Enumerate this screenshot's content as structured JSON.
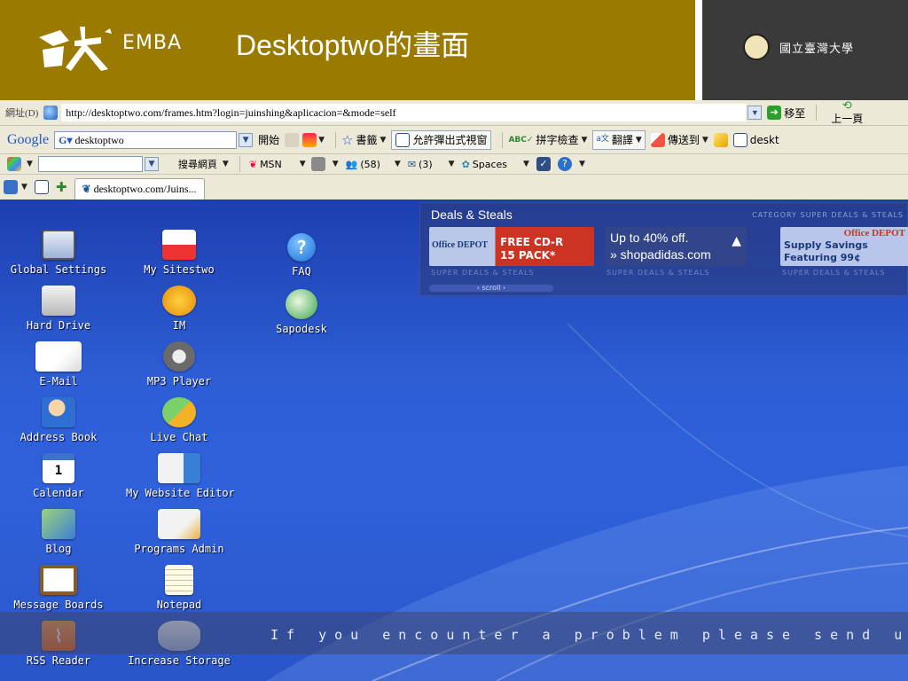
{
  "header": {
    "emba_label": "EMBA",
    "title": "Desktoptwo的畫面",
    "university": "國立臺灣大學"
  },
  "address_bar": {
    "label": "網址(D)",
    "url": "http://desktoptwo.com/frames.htm?login=juinshing&aplicacion=&mode=self",
    "go_label": "移至",
    "back_label": "上一頁"
  },
  "google_bar": {
    "logo": "Google",
    "search_value": "desktoptwo",
    "start_label": "開始",
    "bookmarks_label": "書籤",
    "popups_label": "允許彈出式視窗",
    "spellcheck_label": "拼字檢查",
    "translate_label": "翻譯",
    "sendto_label": "傳送到",
    "extra_label": "deskt"
  },
  "links_bar": {
    "search_web_label": "搜尋網頁",
    "msn_label": "MSN",
    "buddies_count": "(58)",
    "mail_count": "(3)",
    "spaces_label": "Spaces"
  },
  "tab": {
    "label": "desktoptwo.com/Juins..."
  },
  "deals": {
    "title": "Deals & Steals",
    "category": "CATEGORY SUPER DEALS & STEALS",
    "ad1_text1": "Office DEPOT",
    "ad1_text2": "FREE CD-R",
    "ad1_text3": "15 PACK*",
    "ad2_text1": "Up to 40% off.",
    "ad2_text2": "» shopadidas.com",
    "ad3_text1": "Office DEPOT",
    "ad3_text2": "Supply Savings",
    "ad3_text3": "Featuring 99¢",
    "caption": "SUPER DEALS & STEALS",
    "scroll_label": "‹ scroll ›"
  },
  "desktop_icons": {
    "global_settings": "Global Settings",
    "my_sitestwo": "My Sitestwo",
    "faq": "FAQ",
    "hard_drive": "Hard Drive",
    "im": "IM",
    "sapodesk": "Sapodesk",
    "email": "E-Mail",
    "mp3_player": "MP3 Player",
    "address_book": "Address Book",
    "live_chat": "Live Chat",
    "calendar": "Calendar",
    "calendar_day": "1",
    "website_editor": "My Website Editor",
    "blog": "Blog",
    "programs_admin": "Programs Admin",
    "message_boards": "Message Boards",
    "notepad": "Notepad",
    "rss_reader": "RSS Reader",
    "increase_storage": "Increase Storage"
  },
  "ticker": {
    "text": "If you encounter a problem please send us a"
  },
  "colors": {
    "header_gold": "#9a7a00",
    "header_dark": "#3a3a3a",
    "chrome": "#ece9d8",
    "desktop_blue": "#2e5ed6"
  }
}
